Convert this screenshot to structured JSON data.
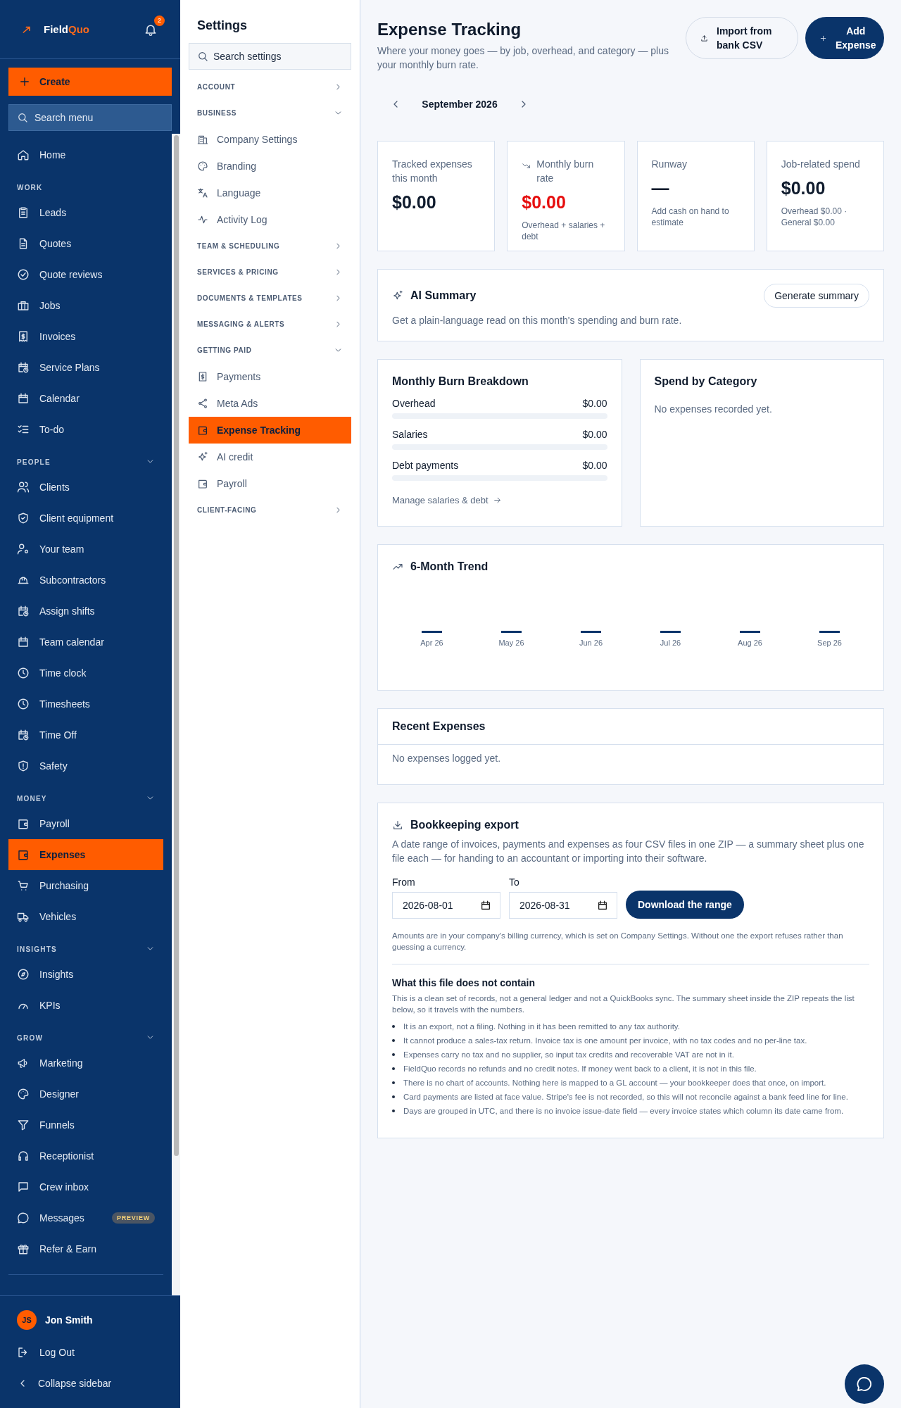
{
  "sidebar": {
    "brand": {
      "part_1": "Field",
      "part_2": "Quo"
    },
    "notification_count": "2",
    "create_label": "Create",
    "search_placeholder": "Search menu",
    "sections": [
      {
        "items": [
          {
            "label": "Home",
            "selected": false
          }
        ]
      },
      {
        "title": "WORK",
        "collapsible": false,
        "items": [
          {
            "label": "Leads",
            "selected": false
          },
          {
            "label": "Quotes",
            "selected": false
          },
          {
            "label": "Quote reviews",
            "selected": false
          },
          {
            "label": "Jobs",
            "selected": false
          },
          {
            "label": "Invoices",
            "selected": false
          },
          {
            "label": "Service Plans",
            "selected": false
          },
          {
            "label": "Calendar",
            "selected": false
          },
          {
            "label": "To-do",
            "selected": false
          }
        ]
      },
      {
        "title": "PEOPLE",
        "collapsible": true,
        "expanded": true,
        "items": [
          {
            "label": "Clients",
            "selected": false
          },
          {
            "label": "Client equipment",
            "selected": false
          },
          {
            "label": "Your team",
            "selected": false
          },
          {
            "label": "Subcontractors",
            "selected": false
          },
          {
            "label": "Assign shifts",
            "selected": false
          },
          {
            "label": "Team calendar",
            "selected": false
          },
          {
            "label": "Time clock",
            "selected": false
          },
          {
            "label": "Timesheets",
            "selected": false
          },
          {
            "label": "Time Off",
            "selected": false
          },
          {
            "label": "Safety",
            "selected": false
          }
        ]
      },
      {
        "title": "MONEY",
        "collapsible": true,
        "expanded": true,
        "items": [
          {
            "label": "Payroll",
            "selected": false
          },
          {
            "label": "Expenses",
            "selected": true
          },
          {
            "label": "Purchasing",
            "selected": false
          },
          {
            "label": "Vehicles",
            "selected": false
          }
        ]
      },
      {
        "title": "INSIGHTS",
        "collapsible": true,
        "expanded": true,
        "items": [
          {
            "label": "Insights",
            "selected": false
          },
          {
            "label": "KPIs",
            "selected": false
          }
        ]
      },
      {
        "title": "GROW",
        "collapsible": true,
        "expanded": true,
        "items": [
          {
            "label": "Marketing",
            "selected": false
          },
          {
            "label": "Designer",
            "selected": false
          },
          {
            "label": "Funnels",
            "selected": false
          },
          {
            "label": "Receptionist",
            "selected": false
          },
          {
            "label": "Crew inbox",
            "selected": false
          },
          {
            "label": "Messages",
            "selected": false,
            "badge": "PREVIEW"
          },
          {
            "label": "Refer & Earn",
            "selected": false
          }
        ]
      }
    ],
    "user": {
      "initials": "JS",
      "name": "Jon Smith"
    },
    "logout": "Log Out",
    "collapse": "Collapse sidebar"
  },
  "settings": {
    "title": "Settings",
    "search_placeholder": "Search settings",
    "groups": [
      {
        "title": "ACCOUNT",
        "expanded": false
      },
      {
        "title": "BUSINESS",
        "expanded": true,
        "items": [
          {
            "label": "Company Settings",
            "selected": false
          },
          {
            "label": "Branding",
            "selected": false
          },
          {
            "label": "Language",
            "selected": false
          },
          {
            "label": "Activity Log",
            "selected": false
          }
        ]
      },
      {
        "title": "TEAM & SCHEDULING",
        "expanded": false
      },
      {
        "title": "SERVICES & PRICING",
        "expanded": false
      },
      {
        "title": "DOCUMENTS & TEMPLATES",
        "expanded": false
      },
      {
        "title": "MESSAGING & ALERTS",
        "expanded": false
      },
      {
        "title": "GETTING PAID",
        "expanded": true,
        "items": [
          {
            "label": "Payments",
            "selected": false
          },
          {
            "label": "Meta Ads",
            "selected": false
          },
          {
            "label": "Expense Tracking",
            "selected": true
          },
          {
            "label": "AI credit",
            "selected": false
          },
          {
            "label": "Payroll",
            "selected": false
          }
        ]
      },
      {
        "title": "CLIENT-FACING",
        "expanded": false
      }
    ]
  },
  "page": {
    "title": "Expense Tracking",
    "subtitle": "Where your money goes — by job, overhead, and category — plus your monthly burn rate.",
    "import_button": "Import from bank CSV",
    "add_button": "Add Expense",
    "month": "September 2026",
    "stats": [
      {
        "label": "Tracked expenses this month",
        "value": "$0.00",
        "alert": false
      },
      {
        "label": "Monthly burn rate",
        "value": "$0.00",
        "note": "Overhead + salaries + debt",
        "alert": true
      },
      {
        "label": "Runway",
        "value": "—",
        "note": "Add cash on hand to estimate",
        "alert": false
      },
      {
        "label": "Job-related spend",
        "value": "$0.00",
        "note": "Overhead $0.00 · General $0.00",
        "alert": false
      }
    ],
    "ai_summary": {
      "title": "AI Summary",
      "button": "Generate summary",
      "text": "Get a plain-language read on this month's spending and burn rate."
    },
    "burn": {
      "title": "Monthly Burn Breakdown",
      "rows": [
        {
          "label": "Overhead",
          "amount": "$0.00",
          "level": 0
        },
        {
          "label": "Salaries",
          "amount": "$0.00",
          "level": 0
        },
        {
          "label": "Debt payments",
          "amount": "$0.00",
          "level": 0
        }
      ],
      "link": "Manage salaries & debt"
    },
    "category": {
      "title": "Spend by Category",
      "empty": "No expenses recorded yet."
    },
    "trend": {
      "title": "6-Month Trend",
      "months": [
        "Apr 26",
        "May 26",
        "Jun 26",
        "Jul 26",
        "Aug 26",
        "Sep 26"
      ]
    },
    "recent": {
      "title": "Recent Expenses",
      "empty": "No expenses logged yet."
    },
    "export": {
      "title": "Bookkeeping export",
      "text": "A date range of invoices, payments and expenses as four CSV files in one ZIP — a summary sheet plus one file each — for handing to an accountant or importing into their software.",
      "from_label": "From",
      "from_value": "2026-08-01",
      "to_label": "To",
      "to_value": "2026-08-31",
      "button": "Download the range",
      "note": "Amounts are in your company's billing currency, which is set on Company Settings. Without one the export refuses rather than guessing a currency.",
      "limits_title": "What this file does not contain",
      "limits_intro": "This is a clean set of records, not a general ledger and not a QuickBooks sync. The summary sheet inside the ZIP repeats the list below, so it travels with the numbers.",
      "limits": [
        "It is an export, not a filing. Nothing in it has been remitted to any tax authority.",
        "It cannot produce a sales-tax return. Invoice tax is one amount per invoice, with no tax codes and no per-line tax.",
        "Expenses carry no tax and no supplier, so input tax credits and recoverable VAT are not in it.",
        "FieldQuo records no refunds and no credit notes. If money went back to a client, it is not in this file.",
        "There is no chart of accounts. Nothing here is mapped to a GL account — your bookkeeper does that once, on import.",
        "Card payments are listed at face value. Stripe's fee is not recorded, so this will not reconcile against a bank feed line for line.",
        "Days are grouped in UTC, and there is no invoice issue-date field — every invoice states which column its date came from."
      ]
    }
  }
}
